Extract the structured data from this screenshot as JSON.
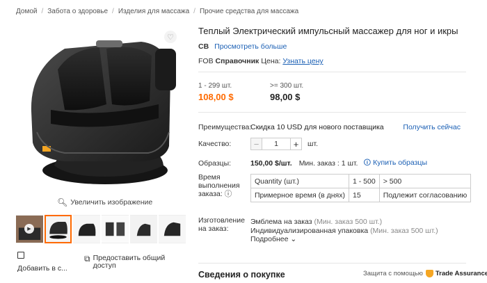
{
  "breadcrumb": [
    "Домой",
    "Забота о здоровье",
    "Изделия для массажа",
    "Прочие средства для массажа"
  ],
  "gallery": {
    "zoom_label": "Увеличить изображение",
    "compare_label": "Добавить в с...",
    "share_label": "Предоставить общий доступ"
  },
  "product": {
    "title": "Теплый Электрический импульсный массажер для ног и икры",
    "supplier_code": "CB",
    "see_more": "Просмотреть больше",
    "fob_prefix": "FOB",
    "fob_bold": "Справочник",
    "fob_price_label": "Цена:",
    "fob_link": "Узнать цену"
  },
  "tiers": [
    {
      "qty": "1 - 299 шт.",
      "price": "108,00 $"
    },
    {
      "qty": ">= 300 шт.",
      "price": "98,00 $"
    }
  ],
  "benefits": {
    "label": "Преимущества:",
    "text": "Скидка 10 USD для нового поставщика",
    "link": "Получить сейчас"
  },
  "quantity": {
    "label": "Качество:",
    "value": "1",
    "unit": "шт."
  },
  "samples": {
    "label": "Образцы:",
    "price": "150,00 $/шт.",
    "min": "Мин. заказ : 1 шт.",
    "link": "Купить образцы"
  },
  "lead_time": {
    "label": "Время выполнения заказа:",
    "rows": [
      [
        "Quantity (шт.)",
        "1 - 500",
        "> 500"
      ],
      [
        "Примерное время (в днях)",
        "15",
        "Подлежит согласованию"
      ]
    ]
  },
  "customization": {
    "label": "Изготовление на заказ:",
    "items": [
      {
        "name": "Эмблема на заказ",
        "note": "(Мин. заказ 500 шт.)"
      },
      {
        "name": "Индивидуализированная упаковка",
        "note": "(Мин. заказ 500 шт.)"
      }
    ],
    "more": "Подробнее"
  },
  "purchase": {
    "title": "Сведения о покупке",
    "protection": "Защита с помощью",
    "brand": "Trade Assurance"
  },
  "colors": {
    "accent": "#ff6a00",
    "link": "#1a5fb4"
  }
}
